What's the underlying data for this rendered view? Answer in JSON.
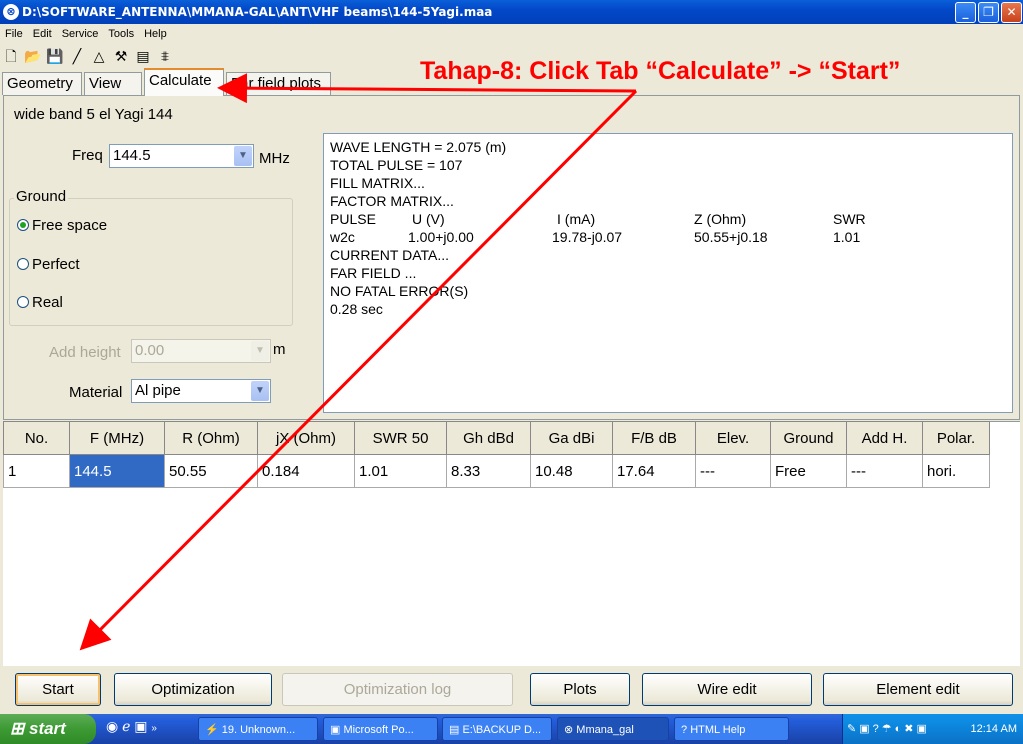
{
  "window": {
    "title": "D:\\SOFTWARE_ANTENNA\\MMANA-GAL\\ANT\\VHF beams\\144-5Yagi.maa"
  },
  "menu": [
    "File",
    "Edit",
    "Service",
    "Tools",
    "Help"
  ],
  "tabs": [
    "Geometry",
    "View",
    "Calculate",
    "Far field plots"
  ],
  "annotation": "Tahap-8: Click Tab “Calculate” -> “Start”",
  "panel": {
    "name": "wide band 5 el Yagi 144",
    "freq_label": "Freq",
    "freq_value": "144.5",
    "freq_unit": "MHz",
    "ground_label": "Ground",
    "ground_options": [
      "Free space",
      "Perfect",
      "Real"
    ],
    "ground_selected": "Free space",
    "add_height_label": "Add height",
    "add_height_value": "0.00",
    "add_height_unit": "m",
    "material_label": "Material",
    "material_value": "Al pipe"
  },
  "output": {
    "lines": [
      "WAVE LENGTH = 2.075 (m)",
      "TOTAL PULSE = 107",
      "FILL MATRIX...",
      "FACTOR MATRIX...",
      "CURRENT DATA...",
      "FAR FIELD ...",
      "NO FATAL ERROR(S)",
      "0.28 sec"
    ],
    "pulse_header": [
      "PULSE",
      "U (V)",
      "I (mA)",
      "Z (Ohm)",
      "SWR"
    ],
    "pulse_row": [
      "w2c",
      "1.00+j0.00",
      "19.78-j0.07",
      "50.55+j0.18",
      "1.01"
    ]
  },
  "table": {
    "headers": [
      "No.",
      "F (MHz)",
      "R (Ohm)",
      "jX (Ohm)",
      "SWR 50",
      "Gh dBd",
      "Ga dBi",
      "F/B dB",
      "Elev.",
      "Ground",
      "Add H.",
      "Polar."
    ],
    "rows": [
      [
        "1",
        "144.5",
        "50.55",
        "0.184",
        "1.01",
        "8.33",
        "10.48",
        "17.64",
        "---",
        "Free",
        "---",
        "hori."
      ]
    ]
  },
  "buttons": {
    "start": "Start",
    "optimization": "Optimization",
    "optimization_log": "Optimization log",
    "plots": "Plots",
    "wire_edit": "Wire edit",
    "element_edit": "Element edit"
  },
  "taskbar": {
    "start": "start",
    "tasks": [
      "19. Unknown...",
      "Microsoft Po...",
      "E:\\BACKUP D...",
      "Mmana_gal",
      "HTML Help"
    ],
    "clock": "12:14 AM"
  }
}
